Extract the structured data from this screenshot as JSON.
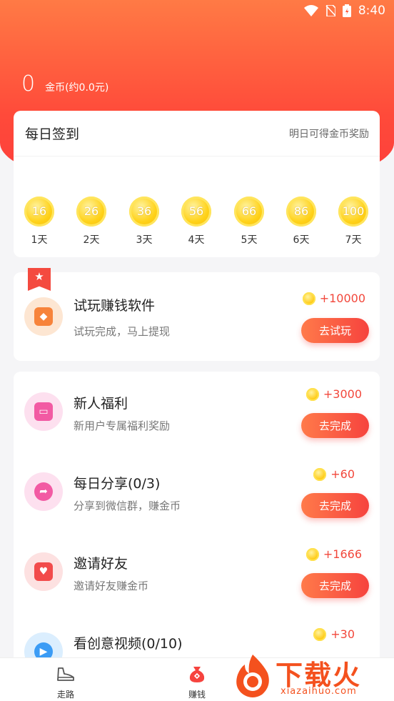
{
  "status": {
    "time": "8:40"
  },
  "balance": {
    "value": "0",
    "label": "金币(约0.0元)"
  },
  "signin": {
    "title": "每日签到",
    "tip": "明日可得金币奖励",
    "days": [
      {
        "coins": "16",
        "label": "1天"
      },
      {
        "coins": "26",
        "label": "2天"
      },
      {
        "coins": "36",
        "label": "3天"
      },
      {
        "coins": "56",
        "label": "4天"
      },
      {
        "coins": "66",
        "label": "5天"
      },
      {
        "coins": "86",
        "label": "6天"
      },
      {
        "coins": "100",
        "label": "7天"
      }
    ]
  },
  "trial": {
    "title": "试玩赚钱软件",
    "subtitle": "试玩完成，马上提现",
    "reward": "+10000",
    "button": "去试玩"
  },
  "tasks": [
    {
      "title": "新人福利",
      "subtitle": "新用户专属福利奖励",
      "reward": "+3000",
      "button": "去完成",
      "icon": "gift-icon"
    },
    {
      "title": "每日分享(0/3)",
      "subtitle": "分享到微信群，赚金币",
      "reward": "+60",
      "button": "去完成",
      "icon": "share-icon"
    },
    {
      "title": "邀请好友",
      "subtitle": "邀请好友赚金币",
      "reward": "+1666",
      "button": "去完成",
      "icon": "invite-icon"
    },
    {
      "title": "看创意视频(0/10)",
      "reward": "+30",
      "icon": "play-icon"
    }
  ],
  "tabbar": {
    "walk": "走路",
    "earn": "赚钱"
  },
  "watermark": {
    "text": "下载火",
    "url": "xiazaihuo.com"
  },
  "colors": {
    "accent": "#f6433e",
    "header": "#ff6a40",
    "coin": "#ffd21a"
  }
}
